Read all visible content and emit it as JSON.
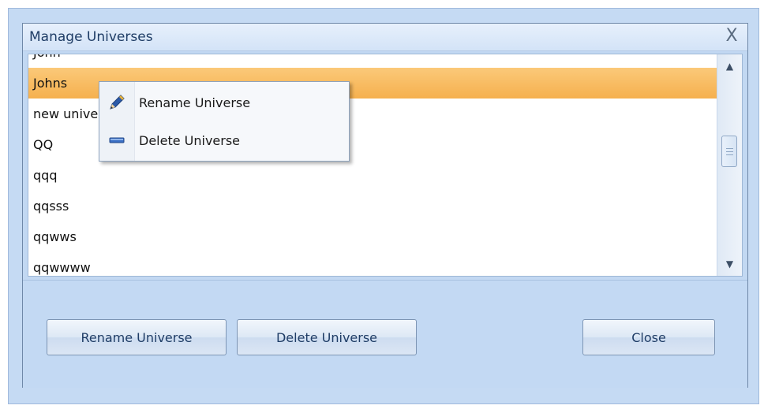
{
  "window": {
    "title": "Manage Universes",
    "close_glyph": "X"
  },
  "list": {
    "items": [
      {
        "label": "John",
        "selected": false
      },
      {
        "label": "Johns",
        "selected": true
      },
      {
        "label": "new universe",
        "selected": false
      },
      {
        "label": "QQ",
        "selected": false
      },
      {
        "label": "qqq",
        "selected": false
      },
      {
        "label": "qqsss",
        "selected": false
      },
      {
        "label": "qqwws",
        "selected": false
      },
      {
        "label": "qqwwww",
        "selected": false
      }
    ],
    "selected_color": "#f7b955"
  },
  "scrollbar": {
    "up_glyph": "▲",
    "down_glyph": "▼"
  },
  "context_menu": {
    "rename_label": "Rename Universe",
    "delete_label": "Delete Universe",
    "rename_icon": "pencil-icon",
    "delete_icon": "minus-icon"
  },
  "buttons": {
    "rename_label": "Rename Universe",
    "delete_label": "Delete Universe",
    "close_label": "Close"
  },
  "colors": {
    "frame": "#c5daf3",
    "title_text": "#1f3d66",
    "accent_blue": "#2d5fa8"
  }
}
